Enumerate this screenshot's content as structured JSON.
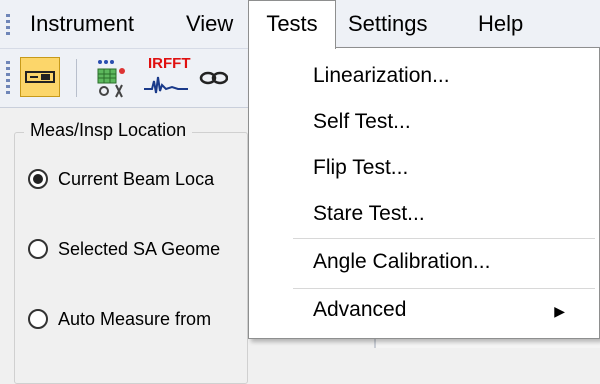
{
  "menubar": {
    "items": [
      "Instrument",
      "View",
      "Tests",
      "Settings",
      "Help"
    ]
  },
  "toolbar": {
    "buttons": [
      {
        "icon": "instrument-connect-icon",
        "active": true
      },
      {
        "icon": "network-grid-icon"
      },
      {
        "icon": "irfft-waveform-icon",
        "label": "IRFFT"
      },
      {
        "icon": "chain-link-icon"
      }
    ]
  },
  "panel": {
    "group_title": "Meas/Insp Location",
    "options": [
      {
        "label": "Current Beam Loca",
        "checked": true
      },
      {
        "label": "Selected SA Geome",
        "checked": false
      },
      {
        "label": "Auto Measure from",
        "checked": false
      }
    ]
  },
  "tests_menu": {
    "items": [
      {
        "label": "Linearization..."
      },
      {
        "label": "Self Test..."
      },
      {
        "label": "Flip Test..."
      },
      {
        "label": "Stare Test..."
      },
      {
        "label": "Angle Calibration..."
      },
      {
        "label": "Advanced",
        "submenu": true
      }
    ]
  },
  "colors": {
    "active_button": "#fcd66a",
    "menubar_bg": "#eef1f6",
    "accent_blue": "#2b6fb8"
  }
}
